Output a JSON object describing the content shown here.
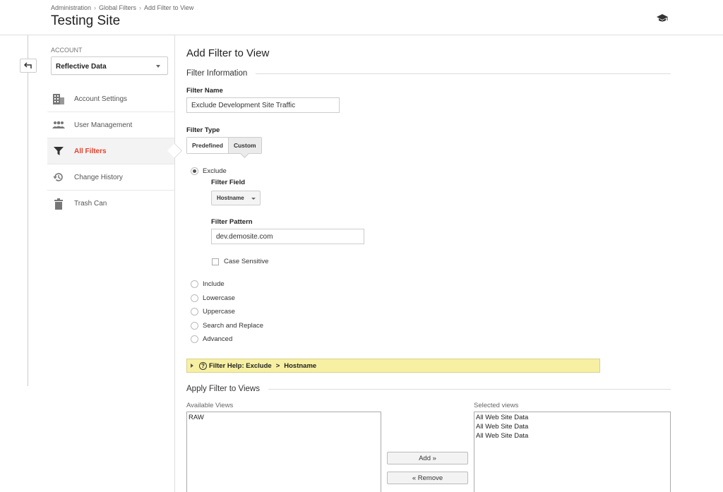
{
  "header": {
    "breadcrumb": [
      "Administration",
      "Global Filters",
      "Add Filter to View"
    ],
    "breadcrumb_sep": "›",
    "title": "Testing Site",
    "academy_icon": "graduation-cap-icon"
  },
  "sidebar": {
    "back_icon": "back-arrow-icon",
    "account_label": "ACCOUNT",
    "account_value": "Reflective Data",
    "items": [
      {
        "label": "Account Settings",
        "icon": "building-icon",
        "active": false
      },
      {
        "label": "User Management",
        "icon": "users-icon",
        "active": false
      },
      {
        "label": "All Filters",
        "icon": "filter-icon",
        "active": true
      },
      {
        "label": "Change History",
        "icon": "history-icon",
        "active": false
      },
      {
        "label": "Trash Can",
        "icon": "trash-icon",
        "active": false
      }
    ],
    "active_color": "#e3442f"
  },
  "main": {
    "title": "Add Filter to View",
    "filter_info_heading": "Filter Information",
    "filter_name_label": "Filter Name",
    "filter_name_value": "Exclude Development Site Traffic",
    "filter_type_label": "Filter Type",
    "filter_type_options": [
      "Predefined",
      "Custom"
    ],
    "filter_type_selected": "Custom",
    "radio_options": {
      "exclude": "Exclude",
      "include": "Include",
      "lowercase": "Lowercase",
      "uppercase": "Uppercase",
      "search_replace": "Search and Replace",
      "advanced": "Advanced"
    },
    "selected_radio": "Exclude",
    "filter_field_label": "Filter Field",
    "filter_field_value": "Hostname",
    "filter_pattern_label": "Filter Pattern",
    "filter_pattern_value": "dev.demosite.com",
    "case_sensitive_label": "Case Sensitive",
    "case_sensitive_checked": false,
    "help": {
      "prefix": "Filter Help: Exclude",
      "arrow": ">",
      "suffix": "Hostname"
    },
    "apply_heading": "Apply Filter to Views",
    "available_label": "Available Views",
    "available_views": [
      "RAW"
    ],
    "selected_label": "Selected views",
    "selected_views": [
      "All Web Site Data",
      "All Web Site Data",
      "All Web Site Data"
    ],
    "add_button": "Add »",
    "remove_button": "« Remove"
  }
}
